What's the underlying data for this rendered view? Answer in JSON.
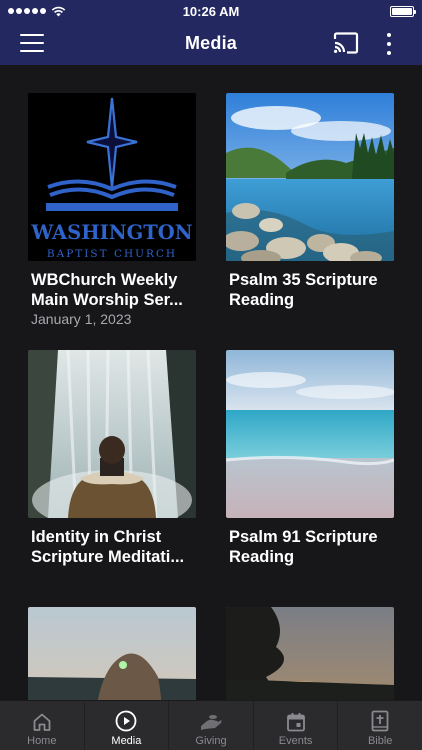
{
  "status_bar": {
    "time": "10:26 AM"
  },
  "header": {
    "title": "Media"
  },
  "media_items": [
    {
      "title": "WBChurch Weekly Main Worship Ser...",
      "date": "January 1, 2023",
      "logo": {
        "name": "WASHINGTON",
        "sub": "BAPTIST CHURCH"
      }
    },
    {
      "title": "Psalm 35 Scripture Reading",
      "date": ""
    },
    {
      "title": "Identity in Christ Scripture Meditati...",
      "date": ""
    },
    {
      "title": "Psalm 91 Scripture Reading",
      "date": ""
    },
    {
      "title": "",
      "date": ""
    },
    {
      "title": "",
      "date": ""
    }
  ],
  "bottom_nav": [
    {
      "label": "Home",
      "icon": "home-icon",
      "active": false
    },
    {
      "label": "Media",
      "icon": "play-circle-icon",
      "active": true
    },
    {
      "label": "Giving",
      "icon": "giving-hand-icon",
      "active": false
    },
    {
      "label": "Events",
      "icon": "calendar-icon",
      "active": false
    },
    {
      "label": "Bible",
      "icon": "bible-icon",
      "active": false
    }
  ],
  "colors": {
    "header_bg": "#232861",
    "page_bg": "#17171a",
    "nav_bg": "#2b2b2e",
    "logo_blue": "#2f63c9"
  }
}
